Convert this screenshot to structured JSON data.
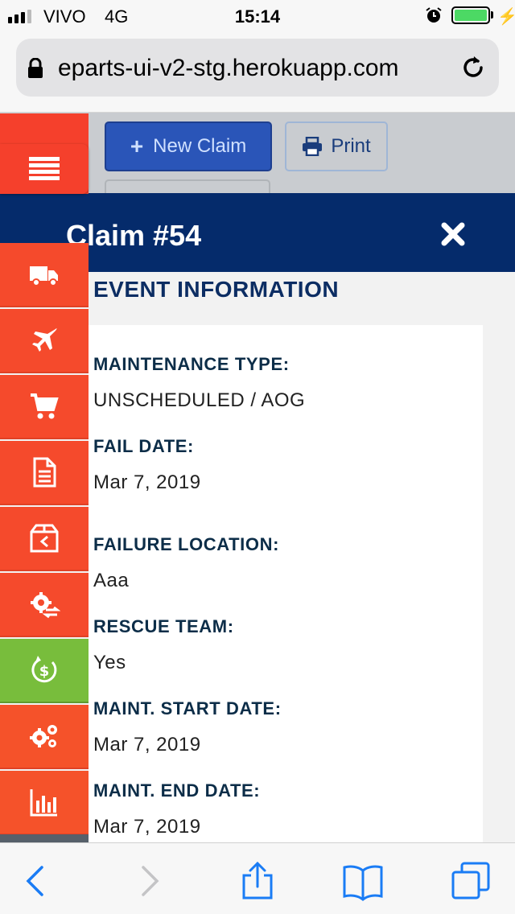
{
  "status_bar": {
    "carrier": "VIVO",
    "network": "4G",
    "time": "15:14",
    "battery_color": "#4cd964"
  },
  "browser": {
    "url": "eparts-ui-v2-stg.herokuapp.com"
  },
  "page": {
    "new_claim_label": "New Claim",
    "print_label": "Print"
  },
  "modal": {
    "title": "Claim #54",
    "section_title": "EVENT INFORMATION",
    "fields": [
      {
        "label": "MAINTENANCE TYPE:",
        "value": "UNSCHEDULED / AOG"
      },
      {
        "label": "FAIL DATE:",
        "value": "Mar 7, 2019"
      },
      {
        "label": "FAILURE LOCATION:",
        "value": "Aaa"
      },
      {
        "label": "RESCUE TEAM:",
        "value": "Yes"
      },
      {
        "label": "MAINT. START DATE:",
        "value": "Mar 7, 2019"
      },
      {
        "label": "MAINT. END DATE:",
        "value": "Mar 7, 2019"
      }
    ]
  },
  "sidebar": {
    "items": [
      {
        "icon": "truck-icon",
        "color": "#f54a2c"
      },
      {
        "icon": "airplane-icon",
        "color": "#f54a2c"
      },
      {
        "icon": "cart-icon",
        "color": "#f54a2c"
      },
      {
        "icon": "document-icon",
        "color": "#f54a2c"
      },
      {
        "icon": "box-return-icon",
        "color": "#f54a2c"
      },
      {
        "icon": "gear-exchange-icon",
        "color": "#f54a2c"
      },
      {
        "icon": "dollar-refresh-icon",
        "color": "#78bd3c"
      },
      {
        "icon": "gears-icon",
        "color": "#f5522a"
      },
      {
        "icon": "bar-chart-icon",
        "color": "#f5522a"
      }
    ]
  },
  "colors": {
    "accent_red": "#f5402c",
    "modal_header": "#052b6b",
    "primary_button": "#2a55b8",
    "ios_blue": "#1a7cf5"
  }
}
